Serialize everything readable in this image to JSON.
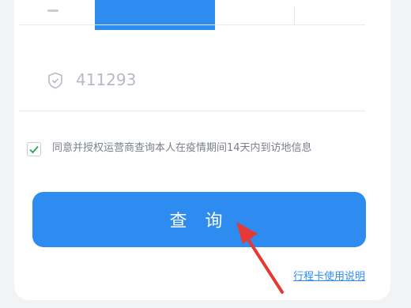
{
  "form": {
    "code_value": "411293",
    "agreement_text": "同意并授权运营商查询本人在疫情期间14天内到访地信息",
    "agreement_checked": true,
    "query_button_label": "查 询",
    "help_link_text": "行程卡使用说明"
  },
  "colors": {
    "accent": "#2e8cf0",
    "arrow": "#e53935",
    "checkmark": "#2aa35a"
  },
  "icons": {
    "code_field": "shield-icon",
    "agreement": "checkbox-check-icon",
    "annotation": "red-arrow-icon"
  }
}
